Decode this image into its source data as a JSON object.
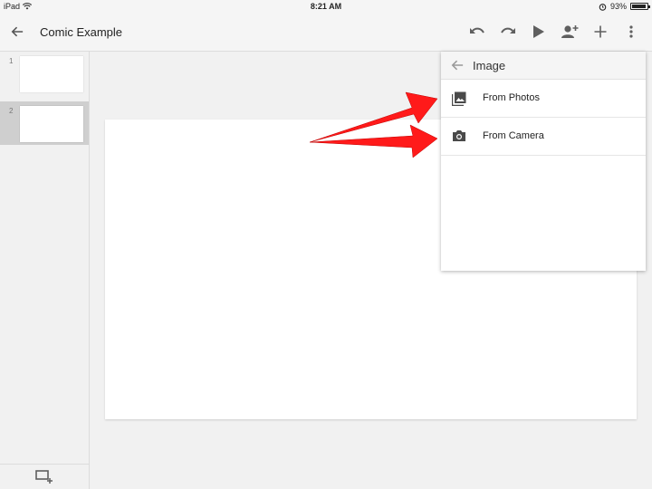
{
  "status_bar": {
    "device": "iPad",
    "time": "8:21 AM",
    "battery": "93%",
    "battery_level": 0.93
  },
  "app_bar": {
    "title": "Comic Example",
    "icons": [
      "arrow-left-icon",
      "undo-icon",
      "redo-icon",
      "play-icon",
      "add-person-icon",
      "plus-icon",
      "more-vert-icon"
    ]
  },
  "sidebar": {
    "slides": [
      {
        "number": "1",
        "selected": false
      },
      {
        "number": "2",
        "selected": true
      }
    ],
    "footer_icon": "new-slide-icon"
  },
  "insert_menu": {
    "title": "Image",
    "items": [
      {
        "label": "From Photos",
        "icon": "photo-library-icon"
      },
      {
        "label": "From Camera",
        "icon": "camera-icon"
      }
    ]
  },
  "colors": {
    "arrow": "#ff1a1a",
    "selected_thumb": "#cfcfcf",
    "icon": "#5f5f5f"
  }
}
